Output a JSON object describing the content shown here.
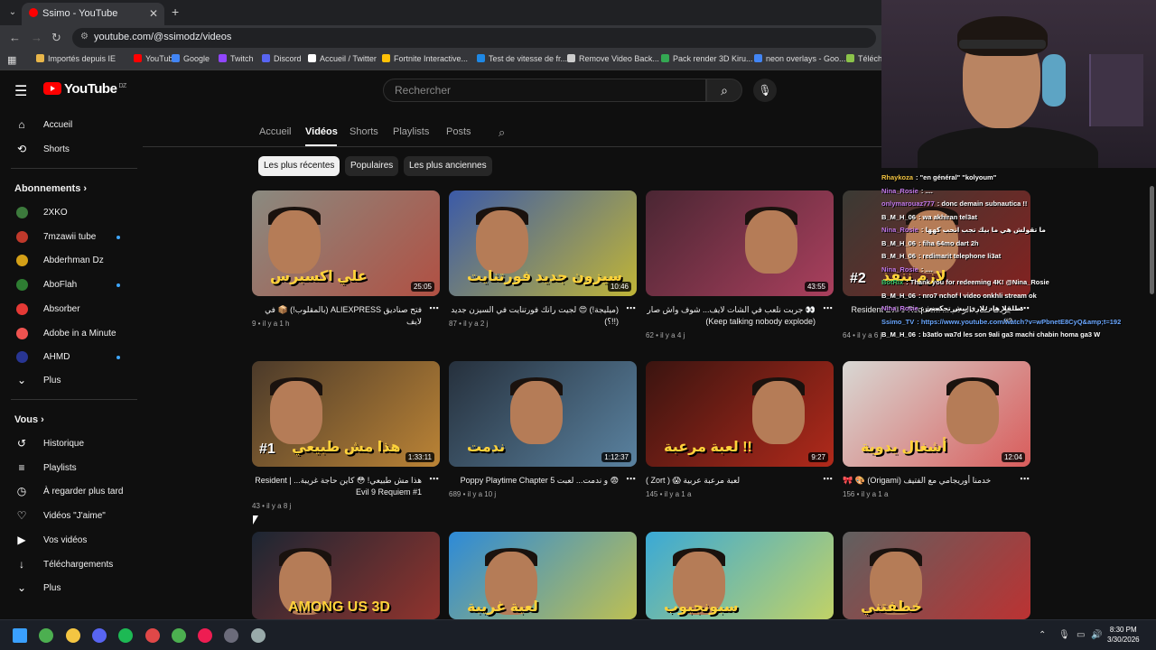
{
  "browser": {
    "tab_title": "Ssimo - YouTube",
    "url": "youtube.com/@ssimodz/videos",
    "bookmarks": [
      {
        "label": "Importés depuis IE",
        "color": "#e8b64a"
      },
      {
        "label": "YouTube",
        "color": "#ff0000"
      },
      {
        "label": "Google",
        "color": "#4285f4"
      },
      {
        "label": "Twitch",
        "color": "#9146ff"
      },
      {
        "label": "Discord",
        "color": "#5865f2"
      },
      {
        "label": "Accueil / Twitter",
        "color": "#ffffff"
      },
      {
        "label": "Fortnite Interactive...",
        "color": "#ffc107"
      },
      {
        "label": "Test de vitesse de fr...",
        "color": "#1e88e5"
      },
      {
        "label": "Remove Video Back...",
        "color": "#cccccc"
      },
      {
        "label": "Pack render 3D Kiru...",
        "color": "#34a853"
      },
      {
        "label": "neon overlays - Goo...",
        "color": "#4285f4"
      },
      {
        "label": "Télécha",
        "color": "#8bc34a"
      }
    ]
  },
  "youtube": {
    "logo_text": "YouTube",
    "region": "DZ",
    "search_placeholder": "Rechercher"
  },
  "sidebar": {
    "main": [
      {
        "label": "Accueil",
        "icon": "home-icon",
        "glyph": "⌂"
      },
      {
        "label": "Shorts",
        "icon": "shorts-icon",
        "glyph": "⟲"
      }
    ],
    "subs_header": "Abonnements",
    "subscriptions": [
      {
        "label": "2XKO",
        "color": "#3c7a3c",
        "dot": false
      },
      {
        "label": "7mzawii tube",
        "color": "#c0392b",
        "dot": true
      },
      {
        "label": "Abderhman Dz",
        "color": "#d4a017",
        "dot": false
      },
      {
        "label": "AboFlah",
        "color": "#2e7d32",
        "dot": true
      },
      {
        "label": "Absorber",
        "color": "#e53935",
        "dot": false
      },
      {
        "label": "Adobe in a Minute",
        "color": "#ef5350",
        "dot": false
      },
      {
        "label": "AHMD",
        "color": "#283593",
        "dot": true
      }
    ],
    "subs_more": "Plus",
    "you_header": "Vous",
    "you": [
      {
        "label": "Historique",
        "icon": "history-icon",
        "glyph": "↺"
      },
      {
        "label": "Playlists",
        "icon": "playlists-icon",
        "glyph": "≡"
      },
      {
        "label": "À regarder plus tard",
        "icon": "watch-later-icon",
        "glyph": "◷"
      },
      {
        "label": "Vidéos \"J'aime\"",
        "icon": "like-icon",
        "glyph": "♡"
      },
      {
        "label": "Vos vidéos",
        "icon": "your-videos-icon",
        "glyph": "▶"
      },
      {
        "label": "Téléchargements",
        "icon": "download-icon",
        "glyph": "↓"
      },
      {
        "label": "Plus",
        "icon": "chevron-down-icon",
        "glyph": "⌄"
      }
    ]
  },
  "channel_tabs": [
    "Accueil",
    "Vidéos",
    "Shorts",
    "Playlists",
    "Posts"
  ],
  "active_tab": "Vidéos",
  "chips": [
    "Les plus récentes",
    "Populaires",
    "Les plus anciennes"
  ],
  "videos": [
    {
      "title": "فتح صناديق ALIEXPRESS (بالمقلوب!) 📦 في لايف",
      "meta": "9 • il y a 1 h",
      "duration": "25:05",
      "overlay": "علي اكسبرس",
      "bg": "#8a8a80",
      "accent": "#c0392b",
      "num": ""
    },
    {
      "title": "(ميليجة!) 😍 لجيت رانك فورتنايت في السيزن جديد (!!؟)",
      "meta": "87 • il y a 2 j",
      "duration": "10:46",
      "overlay": "سيزون جديد فورتنايت",
      "bg": "#3b5aa8",
      "accent": "#f5d90a",
      "num": ""
    },
    {
      "title": "👀 جربت نلعب في الشات لايف... شوف واش صار (Keep talking nobody explode)",
      "meta": "62 • il y a 4 j",
      "duration": "43:55",
      "overlay": "",
      "bg": "#4a2633",
      "accent": "#d04a6e",
      "num": ""
    },
    {
      "title": "جربت نلعب الرعب... Resident Evil 9 Requiem #2",
      "meta": "64 • il y a 6 j",
      "duration": "",
      "overlay": "لازم ننقذ",
      "bg": "#3a3a34",
      "accent": "#a01818",
      "num": "#2"
    },
    {
      "title": "هذا مش طبيعي! 😳 كاين حاجة غريبة... | Resident Evil 9 Requiem #1",
      "meta": "43 • il y a 8 j",
      "duration": "1:33:11",
      "overlay": "هذا مش طبيعي",
      "bg": "#4b3a2a",
      "accent": "#e8a13a",
      "num": "#1"
    },
    {
      "title": "😨 و ندمت... لعبت Poppy Playtime Chapter 5",
      "meta": "689 • il y a 10 j",
      "duration": "1:12:37",
      "overlay": "ندمت",
      "bg": "#26303c",
      "accent": "#6fa3c8",
      "num": ""
    },
    {
      "title": "( Zort ) 😱 لعبة مرعبة عربية",
      "meta": "145 • il y a 1 a",
      "duration": "9:27",
      "overlay": "لعبة مرعبة !!",
      "bg": "#3a1410",
      "accent": "#e0321f",
      "num": ""
    },
    {
      "title": "🎀 🎨 (Origami) خدمنا أوريجامي مع الفتيف",
      "meta": "156 • il y a 1 a",
      "duration": "12:04",
      "overlay": "أشغال يدوية",
      "bg": "#d8d8d4",
      "accent": "#d92b2b",
      "num": ""
    },
    {
      "title": "",
      "meta": "",
      "duration": "",
      "overlay": "AMONG US 3D",
      "bg": "#1c2633",
      "accent": "#c0392b",
      "num": ""
    },
    {
      "title": "",
      "meta": "",
      "duration": "",
      "overlay": "لعبة غريبة",
      "bg": "#2d8ad8",
      "accent": "#f7d51d",
      "num": ""
    },
    {
      "title": "",
      "meta": "",
      "duration": "",
      "overlay": "سبونجبوب",
      "bg": "#3aa9d6",
      "accent": "#f7e23a",
      "num": ""
    },
    {
      "title": "",
      "meta": "",
      "duration": "",
      "overlay": "خطفتني",
      "bg": "#606060",
      "accent": "#e02020",
      "num": ""
    }
  ],
  "chat": [
    {
      "user": "Rhaykoza",
      "color": "#f4c542",
      "msg": ": \"en général\" \"kolyoum\""
    },
    {
      "user": "Nina_Rosie",
      "color": "#c178e8",
      "msg": ": ...."
    },
    {
      "user": "onlymarouaz777",
      "color": "#c178e8",
      "msg": ": donc demain subnautica !!"
    },
    {
      "user": "B_M_H_06",
      "color": "#ffffff",
      "msg": ": wa akhiran tel3at"
    },
    {
      "user": "Nina_Rosie",
      "color": "#c178e8",
      "msg": ": ما تقولش هي ما بيك تجب انحب كهها"
    },
    {
      "user": "B_M_H_06",
      "color": "#ffffff",
      "msg": ": fiha 64mo dart 2h"
    },
    {
      "user": "B_M_H_06",
      "color": "#ffffff",
      "msg": ": redimarit telephone li3at"
    },
    {
      "user": "Nina_Rosie",
      "color": "#c178e8",
      "msg": ": ...."
    },
    {
      "user": "BotRix",
      "color": "#3ec76a",
      "msg": ": Thank you for redeeming 4K! @Nina_Rosie"
    },
    {
      "user": "B_M_H_06",
      "color": "#ffffff",
      "msg": ": nro7 nchof l video onkhli stream ok"
    },
    {
      "user": "Nina_Rosie",
      "color": "#c178e8",
      "msg": ": نطلقلا هاد تلاري بيش تحكمني"
    },
    {
      "user": "Ssimo_TV",
      "color": "#6aa7ff",
      "msg": ": https://www.youtube.com/watch?v=wPbnetE8CyQ&amp;t=192"
    },
    {
      "user": "B_M_H_06",
      "color": "#ffffff",
      "msg": ": b3atlo wa7d les son 9ali ga3 machi chabin homa ga3 W"
    }
  ],
  "taskbar": {
    "time": "8:30 PM",
    "date": "3/30/2026",
    "apps": [
      {
        "name": "windows-start-icon",
        "color": "#3aa0ff"
      },
      {
        "name": "chrome-icon",
        "color": "#4caf50"
      },
      {
        "name": "file-explorer-icon",
        "color": "#f4c542"
      },
      {
        "name": "discord-icon",
        "color": "#5865f2"
      },
      {
        "name": "spotify-icon",
        "color": "#1db954"
      },
      {
        "name": "app-icon",
        "color": "#e04848"
      },
      {
        "name": "chrome-alt-icon",
        "color": "#4caf50"
      },
      {
        "name": "tiktok-icon",
        "color": "#ee1d52"
      },
      {
        "name": "obs-icon",
        "color": "#6b6b7a"
      },
      {
        "name": "settings-icon",
        "color": "#9aa"
      }
    ]
  }
}
